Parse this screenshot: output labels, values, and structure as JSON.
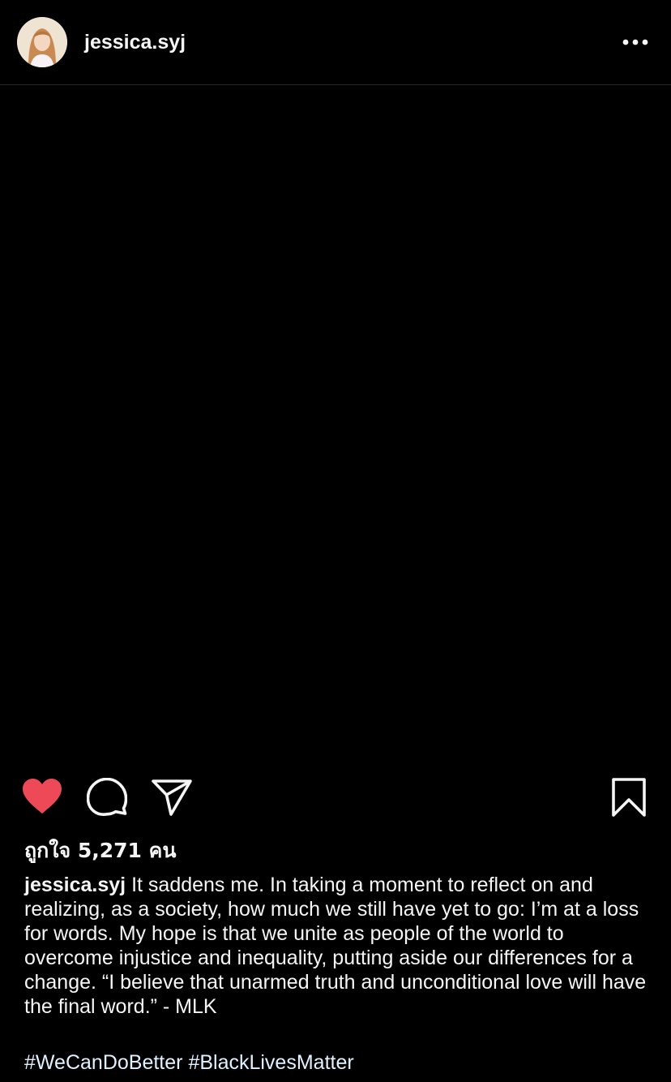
{
  "post": {
    "username": "jessica.syj",
    "likes_text": "ถูกใจ 5,271 คน",
    "caption_user": "jessica.syj",
    "caption_text": "It saddens me. In taking a moment to reflect on and realizing, as a society, how much we still have yet to go: I’m at a loss for words. My hope is that we unite as people of the world to overcome injustice and inequality, putting aside our differences for a change. “I believe that unarmed truth and unconditional love will have the final word.” - MLK",
    "hashtags": [
      "#WeCanDoBetter",
      "#BlackLivesMatter"
    ]
  },
  "icons": {
    "more": "more-horizontal-icon",
    "like": "heart-filled-icon",
    "comment": "comment-bubble-icon",
    "share": "paper-plane-icon",
    "save": "bookmark-icon"
  },
  "colors": {
    "background": "#000000",
    "text": "#f5f5f5",
    "like_active": "#ed4956",
    "hashtag": "#e0f1ff",
    "divider": "#262626"
  }
}
